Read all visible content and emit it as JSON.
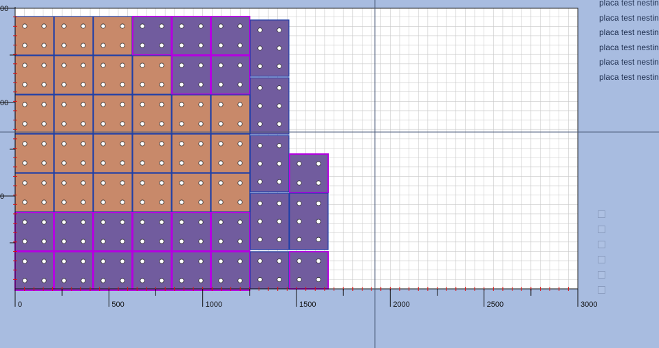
{
  "viewport": {
    "x_axis": {
      "min": 0,
      "max": 3000,
      "major_ticks": [
        0,
        500,
        1000,
        1500,
        2000,
        2500,
        3000
      ],
      "tick_labels": [
        "0",
        "500",
        "1000",
        "1500",
        "2000",
        "2500",
        "3000"
      ],
      "minor_step": 50
    },
    "y_axis": {
      "visible_labels": [
        "00",
        "00",
        "0"
      ]
    },
    "grid": true,
    "crosshair": {
      "x": 1920,
      "y_label_row": "middle"
    }
  },
  "colors": {
    "background": "#a8bce0",
    "plot": "#ffffff",
    "grid": "#c8c8c8",
    "part_orange": "#c8896a",
    "part_purple": "#715c9e",
    "border_blue": "#1f3fa8",
    "border_magenta": "#b400e0",
    "hole": "#ffffff",
    "tick_red": "#e01010"
  },
  "parts": {
    "column_x_ranges": [
      [
        0,
        200
      ],
      [
        210,
        410
      ],
      [
        420,
        620
      ],
      [
        630,
        830
      ],
      [
        840,
        1040
      ],
      [
        1050,
        1250
      ],
      [
        1260,
        1460
      ],
      [
        1470,
        1670
      ]
    ],
    "rows_y_ranges": [
      [
        -2,
        198
      ],
      [
        208,
        408
      ],
      [
        418,
        618
      ],
      [
        628,
        828
      ],
      [
        838,
        1038
      ],
      [
        1048,
        1248
      ],
      [
        1258,
        1458
      ]
    ],
    "grid": [
      [
        "orange",
        "orange",
        "orange",
        "purple",
        "purple",
        "purple"
      ],
      [
        "orange",
        "orange",
        "orange",
        "orange",
        "purple",
        "purple"
      ],
      [
        "orange",
        "orange",
        "orange",
        "orange",
        "orange",
        "orange"
      ],
      [
        "orange",
        "orange",
        "orange",
        "orange",
        "orange",
        "orange"
      ],
      [
        "orange",
        "orange",
        "orange",
        "orange",
        "orange",
        "orange"
      ],
      [
        "purple",
        "purple",
        "purple",
        "purple",
        "purple",
        "purple"
      ],
      [
        "purple",
        "purple",
        "purple",
        "purple",
        "purple",
        "purple"
      ]
    ],
    "magenta_borders": [
      [
        0,
        3
      ],
      [
        0,
        4
      ],
      [
        0,
        5
      ],
      [
        1,
        4
      ],
      [
        1,
        5
      ],
      [
        5,
        0
      ],
      [
        5,
        1
      ],
      [
        5,
        2
      ],
      [
        5,
        3
      ],
      [
        5,
        4
      ],
      [
        5,
        5
      ],
      [
        6,
        0
      ],
      [
        6,
        1
      ],
      [
        6,
        2
      ],
      [
        6,
        3
      ],
      [
        6,
        4
      ],
      [
        6,
        5
      ]
    ],
    "column_seven_parts": [
      {
        "x_range": [
          1260,
          1460
        ],
        "y_range": [
          0,
          300
        ],
        "holes": 3
      },
      {
        "x_range": [
          1260,
          1460
        ],
        "y_range": [
          310,
          610
        ],
        "holes": 3
      },
      {
        "x_range": [
          1260,
          1460
        ],
        "y_range": [
          620,
          920
        ],
        "holes": 3
      },
      {
        "x_range": [
          1260,
          1460
        ],
        "y_range": [
          930,
          1230
        ],
        "holes": 3
      },
      {
        "x_range": [
          1260,
          1460
        ],
        "y_range": [
          1240,
          1440
        ],
        "holes": 2
      }
    ],
    "column_eight_parts": [
      {
        "x_range": [
          1470,
          1670
        ],
        "y_range": [
          0,
          200
        ],
        "holes": 2,
        "border": "magenta"
      },
      {
        "x_range": [
          1470,
          1670
        ],
        "y_range": [
          210,
          510
        ],
        "holes": 3
      },
      {
        "x_range": [
          1470,
          1670
        ],
        "y_range": [
          520,
          720
        ],
        "holes": 2,
        "border": "magenta"
      }
    ]
  },
  "list_items": [
    "placa test nesting",
    "placa test nesting",
    "placa test nesting",
    "placa test nesting",
    "placa test nesting",
    "placa test nesting"
  ],
  "checkboxes": [
    {
      "checked": false
    },
    {
      "checked": false
    },
    {
      "checked": false
    },
    {
      "checked": false
    },
    {
      "checked": false
    },
    {
      "checked": false
    }
  ]
}
